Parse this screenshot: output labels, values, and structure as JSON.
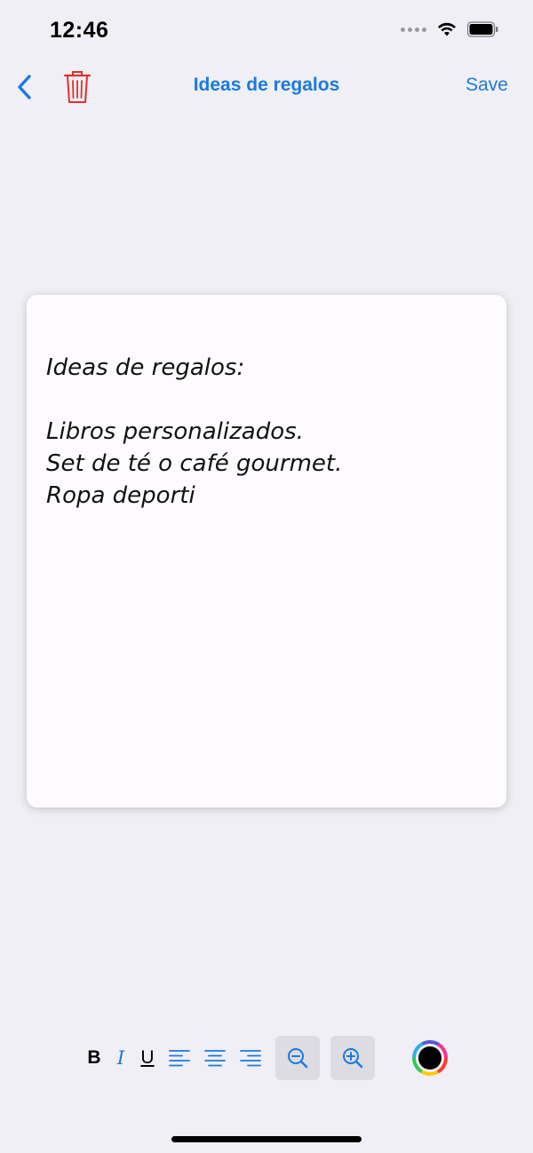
{
  "status_bar": {
    "time": "12:46"
  },
  "nav": {
    "title": "Ideas de regalos",
    "save_label": "Save"
  },
  "note": {
    "text": "Ideas de regalos:\n\nLibros personalizados.\nSet de té o café gourmet.\nRopa deporti"
  },
  "toolbar": {
    "bold_label": "B",
    "italic_label": "I",
    "underline_label": "U"
  },
  "colors": {
    "accent": "#1a7ae0",
    "danger": "#e0302a",
    "background": "#f0eff5",
    "card": "#fdfbfe",
    "selected_text_color": "#000000"
  },
  "icons": {
    "back": "chevron-left-icon",
    "trash": "trash-icon",
    "align_left": "align-left-icon",
    "align_center": "align-center-icon",
    "align_right": "align-right-icon",
    "zoom_out": "zoom-out-icon",
    "zoom_in": "zoom-in-icon",
    "color_picker": "color-wheel-icon"
  }
}
